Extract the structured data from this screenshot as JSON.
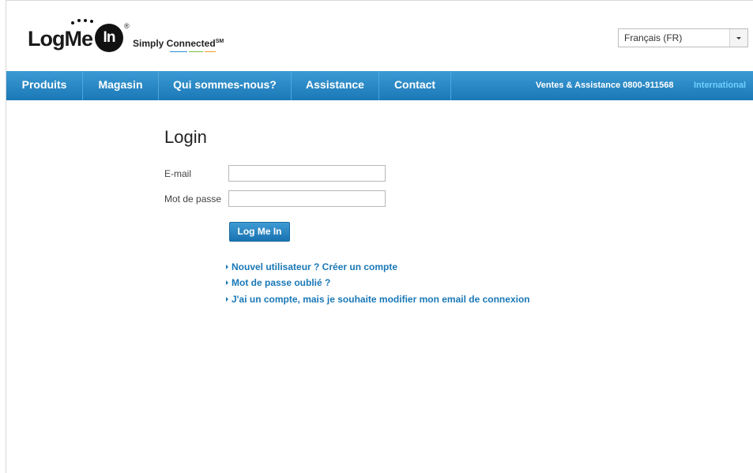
{
  "header": {
    "logo_text": "LogMe",
    "logo_in": "In",
    "logo_registered": "®",
    "tagline": "Simply Connected",
    "tagline_mark": "SM",
    "language": {
      "selected": "Français (FR)",
      "dropdown_icon": "chevron-down-icon"
    }
  },
  "nav": {
    "items": [
      {
        "label": "Produits"
      },
      {
        "label": "Magasin"
      },
      {
        "label": "Qui sommes-nous?"
      },
      {
        "label": "Assistance"
      },
      {
        "label": "Contact"
      }
    ],
    "sales_info": "Ventes & Assistance 0800-911568",
    "international_link": "International"
  },
  "login": {
    "title": "Login",
    "email_label": "E-mail",
    "email_value": "",
    "password_label": "Mot de passe",
    "password_value": "",
    "submit_label": "Log Me In",
    "links": [
      {
        "label": "Nouvel utilisateur ? Créer un compte"
      },
      {
        "label": "Mot de passe oublié ?"
      },
      {
        "label": "J'ai un compte, mais je souhaite modifier mon email de connexion"
      }
    ]
  },
  "colors": {
    "nav_top": "#3b9ad3",
    "nav_bottom": "#1b78b7",
    "link": "#1a78b6",
    "international": "#6fd0ff"
  }
}
